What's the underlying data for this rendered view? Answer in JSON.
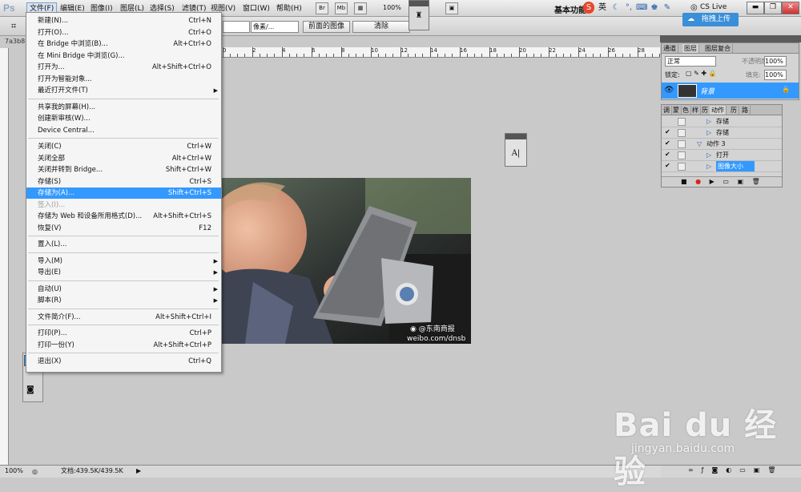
{
  "app": {
    "logo": "Ps"
  },
  "menubar": {
    "items": [
      "文件(F)",
      "编辑(E)",
      "图像(I)",
      "图层(L)",
      "选择(S)",
      "滤镜(T)",
      "视图(V)",
      "窗口(W)",
      "帮助(H)"
    ],
    "zoom": "100%",
    "workspace": "基本功能",
    "ime_lang": "英",
    "cs_live": "CS Live",
    "min": "▬",
    "restore": "❐",
    "close": "✕"
  },
  "optionsbar": {
    "unit": "像素/...",
    "front_image": "前面的图像",
    "clear": "清除"
  },
  "upload_button": "拖拽上传",
  "document": {
    "tab": "7a3b8"
  },
  "ruler": {
    "labels": [
      "0",
      "2",
      "4",
      "6",
      "8",
      "10",
      "12",
      "14",
      "16",
      "18",
      "20",
      "22",
      "24",
      "26",
      "28"
    ]
  },
  "file_menu": {
    "items": [
      {
        "label": "新建(N)...",
        "shortcut": "Ctrl+N"
      },
      {
        "label": "打开(O)...",
        "shortcut": "Ctrl+O"
      },
      {
        "label": "在 Bridge 中浏览(B)...",
        "shortcut": "Alt+Ctrl+O"
      },
      {
        "label": "在 Mini Bridge 中浏览(G)...",
        "shortcut": ""
      },
      {
        "label": "打开为...",
        "shortcut": "Alt+Shift+Ctrl+O"
      },
      {
        "label": "打开为智能对象...",
        "shortcut": ""
      },
      {
        "label": "最近打开文件(T)",
        "shortcut": "",
        "submenu": true
      },
      {
        "sep": true
      },
      {
        "label": "共享我的屏幕(H)...",
        "shortcut": ""
      },
      {
        "label": "创建新审核(W)...",
        "shortcut": ""
      },
      {
        "label": "Device Central...",
        "shortcut": ""
      },
      {
        "sep": true
      },
      {
        "label": "关闭(C)",
        "shortcut": "Ctrl+W"
      },
      {
        "label": "关闭全部",
        "shortcut": "Alt+Ctrl+W"
      },
      {
        "label": "关闭并转到 Bridge...",
        "shortcut": "Shift+Ctrl+W"
      },
      {
        "label": "存储(S)",
        "shortcut": "Ctrl+S"
      },
      {
        "label": "存储为(A)...",
        "shortcut": "Shift+Ctrl+S",
        "highlight": true
      },
      {
        "label": "签入(I)...",
        "shortcut": "",
        "disabled": true
      },
      {
        "label": "存储为 Web 和设备所用格式(D)...",
        "shortcut": "Alt+Shift+Ctrl+S"
      },
      {
        "label": "恢复(V)",
        "shortcut": "F12"
      },
      {
        "sep": true
      },
      {
        "label": "置入(L)...",
        "shortcut": ""
      },
      {
        "sep": true
      },
      {
        "label": "导入(M)",
        "shortcut": "",
        "submenu": true
      },
      {
        "label": "导出(E)",
        "shortcut": "",
        "submenu": true
      },
      {
        "sep": true
      },
      {
        "label": "自动(U)",
        "shortcut": "",
        "submenu": true
      },
      {
        "label": "脚本(R)",
        "shortcut": "",
        "submenu": true
      },
      {
        "sep": true
      },
      {
        "label": "文件简介(F)...",
        "shortcut": "Alt+Shift+Ctrl+I"
      },
      {
        "sep": true
      },
      {
        "label": "打印(P)...",
        "shortcut": "Ctrl+P"
      },
      {
        "label": "打印一份(Y)",
        "shortcut": "Alt+Shift+Ctrl+P"
      },
      {
        "sep": true
      },
      {
        "label": "退出(X)",
        "shortcut": "Ctrl+Q"
      }
    ]
  },
  "layers_panel": {
    "tabs": [
      "通道",
      "图层",
      "图层复合"
    ],
    "blend_mode": "正常",
    "opacity_label": "不透明度:",
    "opacity": "100%",
    "lock_label": "锁定:",
    "fill_label": "填充:",
    "fill": "100%",
    "layer_name": "背景"
  },
  "actions_panel": {
    "tabs": [
      "调",
      "蒙",
      "色",
      "样",
      "历",
      "动作",
      "历",
      "路"
    ],
    "rows": [
      {
        "label": "存储",
        "indent": 2,
        "checked": false
      },
      {
        "label": "存储",
        "indent": 2,
        "checked": true
      },
      {
        "label": "动作 3",
        "indent": 1,
        "checked": true
      },
      {
        "label": "打开",
        "indent": 2,
        "checked": true
      },
      {
        "label": "图像大小",
        "indent": 2,
        "checked": true,
        "highlight": true
      }
    ]
  },
  "photo": {
    "watermark_line1": "@东南商报",
    "watermark_line2": "weibo.com/dnsb"
  },
  "char_panel": {
    "glyph": "A|"
  },
  "status": {
    "zoom": "100%",
    "doc": "文档:439.5K/439.5K"
  },
  "baidu": {
    "logo": "Bai du 经验",
    "url": "jingyan.baidu.com"
  },
  "colors": {
    "highlight": "#3399ff",
    "accent": "#3a8fd8"
  }
}
